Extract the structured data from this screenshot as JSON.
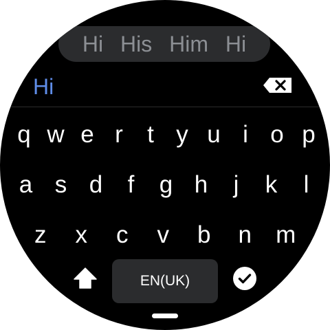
{
  "suggestions": [
    "Hi",
    "His",
    "Him",
    "Hi"
  ],
  "input": {
    "text": "Hi"
  },
  "keyboard": {
    "row1": [
      "q",
      "w",
      "e",
      "r",
      "t",
      "y",
      "u",
      "i",
      "o",
      "p"
    ],
    "row2": [
      "a",
      "s",
      "d",
      "f",
      "g",
      "h",
      "j",
      "k",
      "l"
    ],
    "row3": [
      "z",
      "x",
      "c",
      "v",
      "b",
      "n",
      "m"
    ],
    "language_label": "EN(UK)"
  },
  "icons": {
    "backspace": "backspace-icon",
    "shift": "shift-icon",
    "done": "checkmark-icon"
  },
  "colors": {
    "background": "#000000",
    "suggestion_pill": "#2b2c2e",
    "suggestion_text": "#8c8f94",
    "input_text": "#5f8de8",
    "key_text": "#ffffff"
  }
}
